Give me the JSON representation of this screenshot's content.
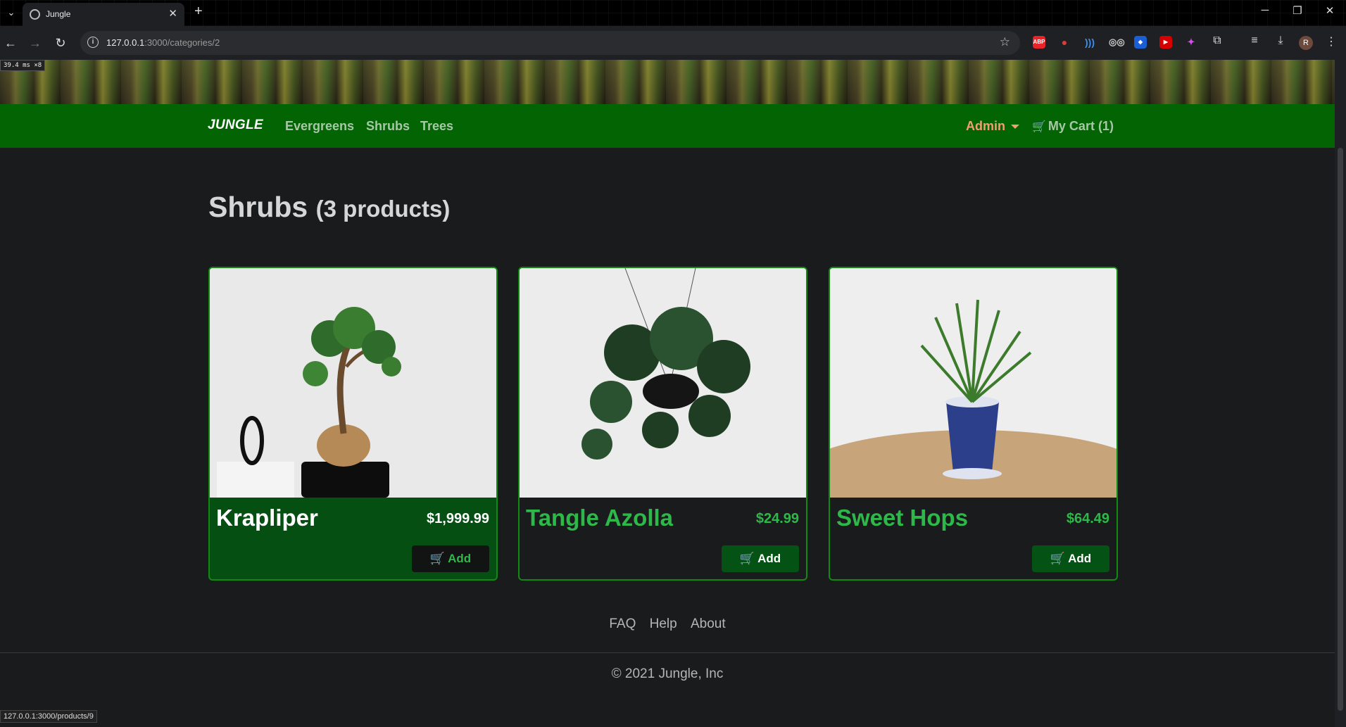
{
  "browser": {
    "tab_title": "Jungle",
    "url_host": "127.0.0.1",
    "url_path": ":3000/categories/2",
    "profile_initial": "R",
    "extensions": [
      {
        "icon": "abp-icon",
        "label": "ABP",
        "color": "#e8242a"
      },
      {
        "icon": "adblock-icon",
        "label": "",
        "color": "#c0392b"
      },
      {
        "icon": "wifi-extension-icon",
        "label": "",
        "color": "#1a6fd6"
      },
      {
        "icon": "glasses-icon",
        "label": "",
        "color": "#555555"
      },
      {
        "icon": "shield-extension-icon",
        "label": "",
        "color": "#1a5fd6"
      },
      {
        "icon": "youtube-extension-icon",
        "label": "",
        "color": "#d60000"
      },
      {
        "icon": "color-picker-icon",
        "label": "",
        "color": "#5b3fd6"
      }
    ],
    "perf_badge": "39.4 ms ×8",
    "status_url": "127.0.0.1:3000/products/9"
  },
  "nav": {
    "brand": "JUNGLE",
    "links": [
      "Evergreens",
      "Shrubs",
      "Trees"
    ],
    "admin": "Admin",
    "cart": "My Cart (1)"
  },
  "page": {
    "title": "Shrubs",
    "count": "(3 products)"
  },
  "products": [
    {
      "name": "Krapliper",
      "price": "$1,999.99",
      "add": "Add"
    },
    {
      "name": "Tangle Azolla",
      "price": "$24.99",
      "add": "Add"
    },
    {
      "name": "Sweet Hops",
      "price": "$64.49",
      "add": "Add"
    }
  ],
  "footer": {
    "links": [
      "FAQ",
      "Help",
      "About"
    ],
    "copyright": "© 2021 Jungle, Inc"
  },
  "colors": {
    "navbar": "#036403",
    "accent_green": "#2fb84a",
    "admin_orange": "#f0a070"
  }
}
